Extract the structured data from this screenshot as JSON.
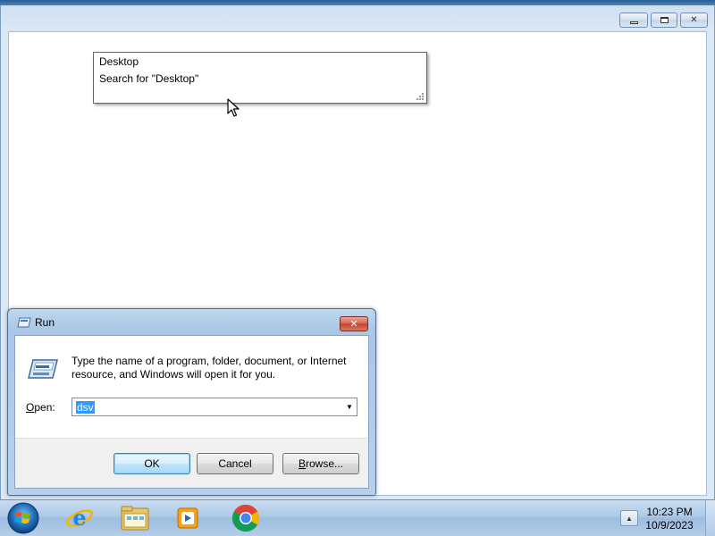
{
  "window": {
    "minimize_icon": "minimize-icon",
    "maximize_icon": "maximize-icon",
    "close_icon": "close-icon"
  },
  "search_dropdown": {
    "items": [
      {
        "label": "Desktop"
      },
      {
        "label": "Search for \"Desktop\""
      }
    ]
  },
  "run_dialog": {
    "title": "Run",
    "close_symbol": "✕",
    "description": "Type the name of a program, folder, document, or Internet resource, and Windows will open it for you.",
    "open_label_accel": "O",
    "open_label_rest": "pen:",
    "open_value": "dsv",
    "ok_label": "OK",
    "cancel_label": "Cancel",
    "browse_label_accel": "B",
    "browse_label_rest": "rowse..."
  },
  "taskbar": {
    "apps": [
      {
        "icon": "internet-explorer-icon"
      },
      {
        "icon": "windows-explorer-icon"
      },
      {
        "icon": "windows-media-player-icon"
      },
      {
        "icon": "chrome-icon"
      }
    ],
    "clock_time": "10:23 PM",
    "clock_date": "10/9/2023"
  },
  "colors": {
    "selection": "#3399ff",
    "titlebar": "#aac7e6",
    "close_red": "#c2402a"
  }
}
